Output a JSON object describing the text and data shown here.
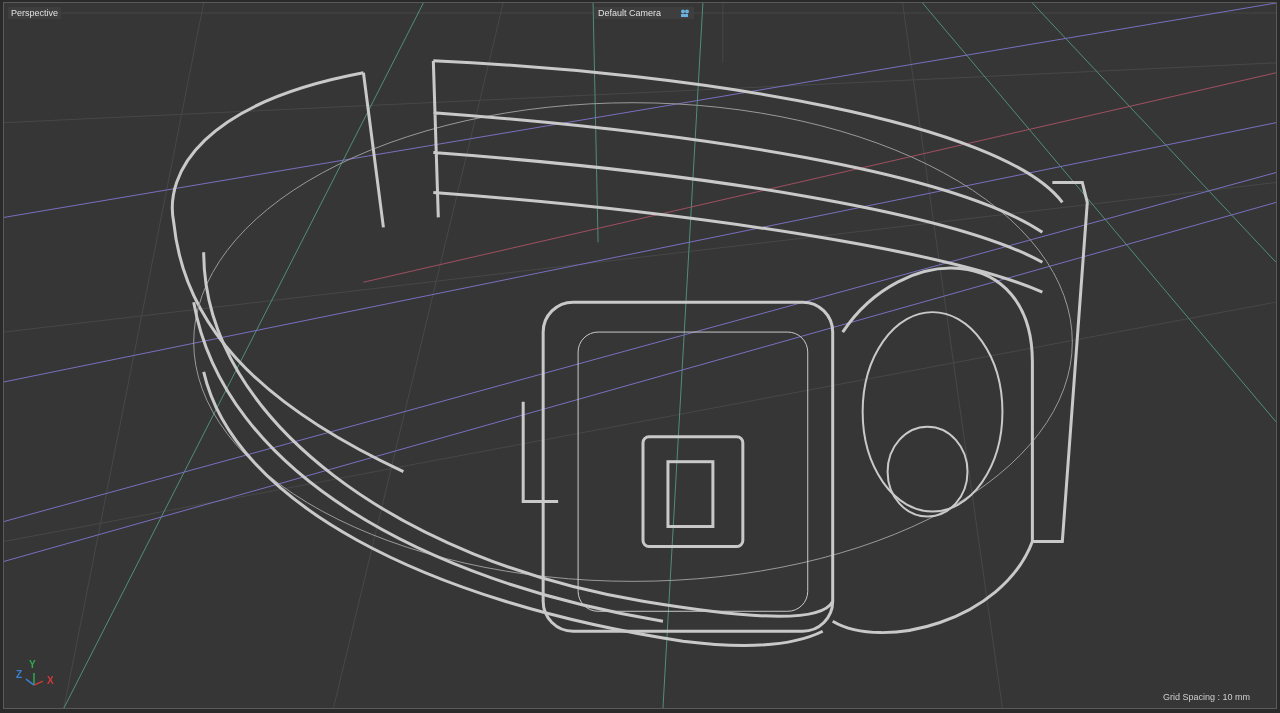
{
  "viewport": {
    "title": "Perspective",
    "camera": "Default Camera",
    "grid_spacing": "Grid Spacing : 10 mm"
  },
  "axes": [
    {
      "label": "Y",
      "color": "#2fa84f"
    },
    {
      "label": "Z",
      "color": "#3a7fd0"
    },
    {
      "label": "X",
      "color": "#d03a3a"
    }
  ]
}
